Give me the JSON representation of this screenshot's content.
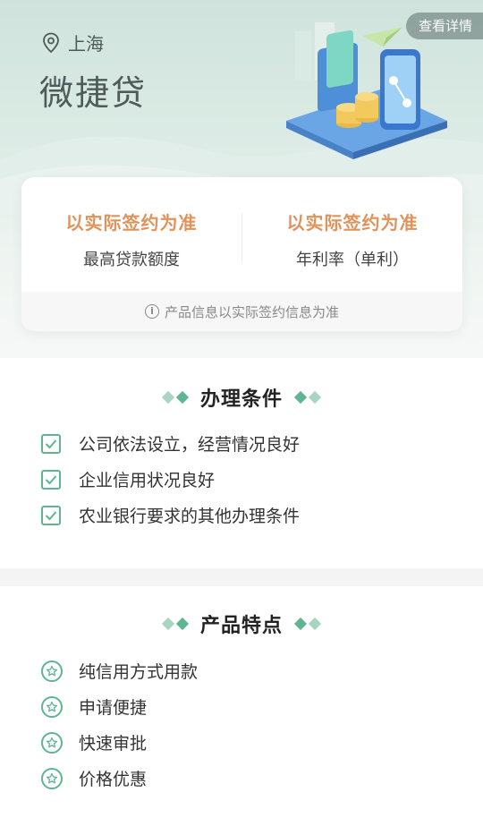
{
  "hero": {
    "detail_button": "查看详情",
    "location": "上海",
    "product_name": "微捷贷"
  },
  "info_card": {
    "stats": [
      {
        "value": "以实际签约为准",
        "label": "最高贷款额度"
      },
      {
        "value": "以实际签约为准",
        "label": "年利率（单利）"
      }
    ],
    "note": "产品信息以实际签约信息为准"
  },
  "conditions": {
    "title": "办理条件",
    "items": [
      "公司依法设立，经营情况良好",
      "企业信用状况良好",
      "农业银行要求的其他办理条件"
    ]
  },
  "features": {
    "title": "产品特点",
    "items": [
      "纯信用方式用款",
      "申请便捷",
      "快速审批",
      "价格优惠"
    ]
  },
  "colors": {
    "accent_green": "#5fb592",
    "highlight_orange": "#e0925a",
    "hero_bg": "#cfe3dc"
  },
  "icons": {
    "location": "location-pin-icon",
    "info": "info-circle-icon",
    "condition": "checkbox-checked-icon",
    "feature": "star-circle-icon"
  }
}
